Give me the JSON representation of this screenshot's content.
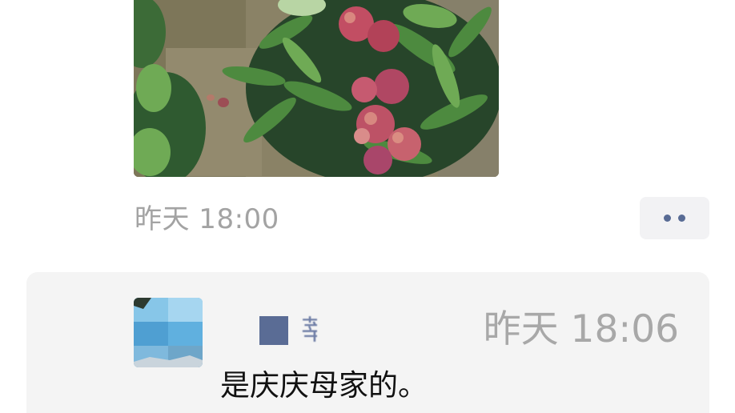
{
  "post": {
    "time": "昨天 18:00",
    "more_icon": "ellipsis-icon"
  },
  "comment": {
    "author_visible_char": "莘",
    "time": "昨天 18:06",
    "text": "是庆庆母家的。"
  },
  "colors": {
    "panel_background": "#f4f4f4",
    "link_blue": "#586b94",
    "timestamp_gray": "#a3a3a3"
  }
}
